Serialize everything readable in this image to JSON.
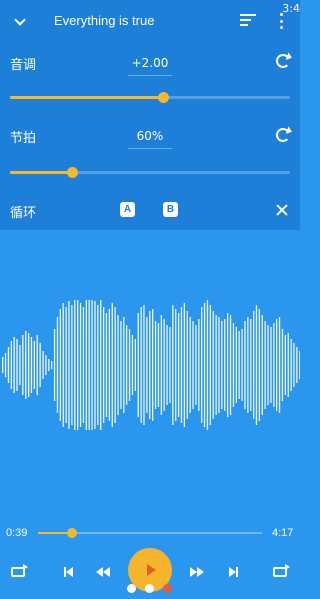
{
  "header": {
    "title": "Everything is true",
    "clock": "3:4"
  },
  "pitch": {
    "label": "音调",
    "value": "+2.00",
    "level": 0.545
  },
  "tempo": {
    "label": "节拍",
    "value": "60%",
    "level": 0.22
  },
  "loop": {
    "label": "循环",
    "a_label": "A",
    "b_label": "B"
  },
  "player": {
    "current_time": "0:39",
    "total_time": "4:17",
    "progress": 0.152
  },
  "colors": {
    "background": "#2a96ee",
    "panel": "#1e7fd8",
    "accent": "#f5b82e",
    "play_button": "#f7b52b"
  },
  "waveform": {
    "amplitudes": [
      8,
      12,
      18,
      24,
      28,
      26,
      20,
      30,
      34,
      32,
      28,
      24,
      30,
      22,
      14,
      10,
      6,
      4,
      36,
      48,
      56,
      62,
      58,
      64,
      60,
      66,
      70,
      62,
      58,
      68,
      74,
      72,
      64,
      60,
      66,
      58,
      52,
      56,
      62,
      58,
      50,
      44,
      48,
      40,
      36,
      30,
      26,
      52,
      58,
      60,
      48,
      54,
      56,
      44,
      42,
      50,
      46,
      40,
      38,
      60,
      56,
      52,
      58,
      62,
      54,
      48,
      44,
      40,
      46,
      58,
      62,
      66,
      60,
      54,
      50,
      48,
      44,
      46,
      52,
      50,
      42,
      38,
      34,
      36,
      44,
      48,
      46,
      54,
      60,
      56,
      50,
      44,
      40,
      38,
      42,
      46,
      48,
      36,
      30,
      32,
      26,
      22,
      18,
      14
    ]
  }
}
